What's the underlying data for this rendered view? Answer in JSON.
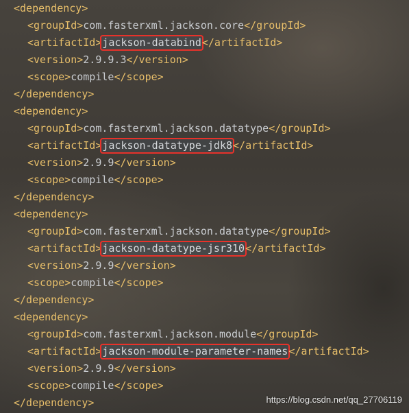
{
  "watermark": "https://blog.csdn.net/qq_27706119",
  "colors": {
    "tag": "#e8bf6a",
    "text": "#c9ccd0",
    "highlight_box": "#e8322a"
  },
  "dependencies": [
    {
      "open": "<dependency>",
      "groupId_open": "<groupId>",
      "groupId": "com.fasterxml.jackson.core",
      "groupId_close": "</groupId>",
      "artifactId_open": "<artifactId>",
      "artifactId": "jackson-databind",
      "artifactId_close": "</artifactId>",
      "version_open": "<version>",
      "version": "2.9.9.3",
      "version_close": "</version>",
      "scope_open": "<scope>",
      "scope": "compile",
      "scope_close": "</scope>",
      "close": "</dependency>"
    },
    {
      "open": "<dependency>",
      "groupId_open": "<groupId>",
      "groupId": "com.fasterxml.jackson.datatype",
      "groupId_close": "</groupId>",
      "artifactId_open": "<artifactId>",
      "artifactId": "jackson-datatype-jdk8",
      "artifactId_close": "</artifactId>",
      "version_open": "<version>",
      "version": "2.9.9",
      "version_close": "</version>",
      "scope_open": "<scope>",
      "scope": "compile",
      "scope_close": "</scope>",
      "close": "</dependency>"
    },
    {
      "open": "<dependency>",
      "groupId_open": "<groupId>",
      "groupId": "com.fasterxml.jackson.datatype",
      "groupId_close": "</groupId>",
      "artifactId_open": "<artifactId>",
      "artifactId": "jackson-datatype-jsr310",
      "artifactId_close": "</artifactId>",
      "version_open": "<version>",
      "version": "2.9.9",
      "version_close": "</version>",
      "scope_open": "<scope>",
      "scope": "compile",
      "scope_close": "</scope>",
      "close": "</dependency>"
    },
    {
      "open": "<dependency>",
      "groupId_open": "<groupId>",
      "groupId": "com.fasterxml.jackson.module",
      "groupId_close": "</groupId>",
      "artifactId_open": "<artifactId>",
      "artifactId": "jackson-module-parameter-names",
      "artifactId_close": "</artifactId>",
      "version_open": "<version>",
      "version": "2.9.9",
      "version_close": "</version>",
      "scope_open": "<scope>",
      "scope": "compile",
      "scope_close": "</scope>",
      "close": "</dependency>"
    }
  ]
}
